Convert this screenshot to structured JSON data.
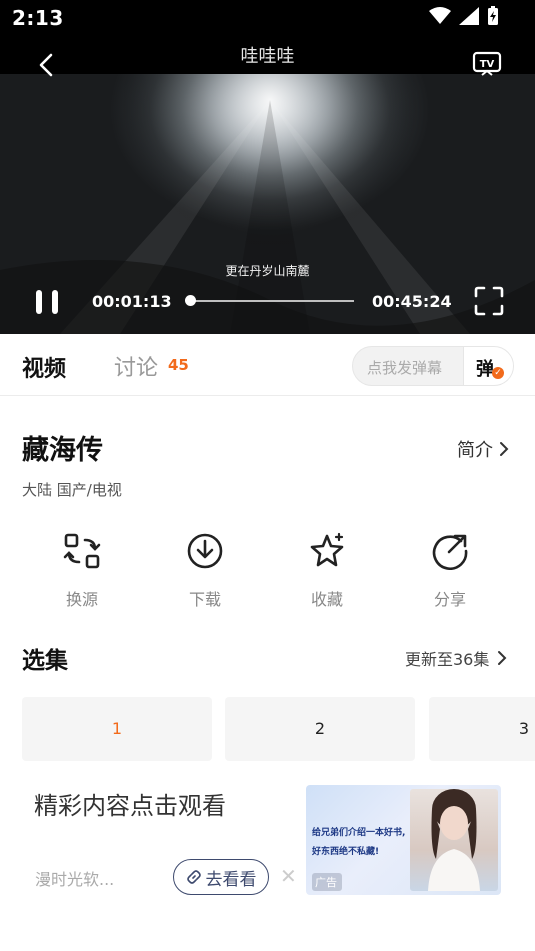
{
  "status": {
    "time": "2:13"
  },
  "player": {
    "title": "哇哇哇",
    "subtitle": "更在丹岁山南麓",
    "current_time": "00:01:13",
    "duration": "00:45:24",
    "progress": 0.027
  },
  "tabs": {
    "video": "视频",
    "discuss": "讨论",
    "discuss_count": "45",
    "danmaku_placeholder": "点我发弹幕",
    "danmaku_toggle": "弹"
  },
  "show": {
    "title": "藏海传",
    "intro": "简介",
    "meta": "大陆  国产/电视"
  },
  "actions": [
    {
      "label": "换源",
      "icon": "swap-source-icon"
    },
    {
      "label": "下载",
      "icon": "download-icon"
    },
    {
      "label": "收藏",
      "icon": "star-icon"
    },
    {
      "label": "分享",
      "icon": "share-icon"
    }
  ],
  "episodes": {
    "title": "选集",
    "update": "更新至36集",
    "items": [
      "1",
      "2",
      "3"
    ]
  },
  "ad": {
    "title": "精彩内容点击观看",
    "source": "漫时光软...",
    "button": "去看看",
    "image_text1": "给兄弟们介绍一本好书,",
    "image_text2": "好东西绝不私藏!",
    "badge": "广告"
  },
  "colors": {
    "accent": "#f26a1b",
    "link_button": "#3e4a6e"
  }
}
